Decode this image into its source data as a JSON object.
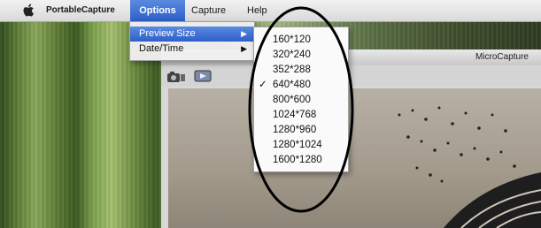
{
  "menubar": {
    "apple_icon": "apple-icon",
    "app_name": "PortableCapture",
    "items": [
      {
        "label": "Options",
        "active": true
      },
      {
        "label": "Capture",
        "active": false
      },
      {
        "label": "Help",
        "active": false
      }
    ]
  },
  "options_menu": {
    "items": [
      {
        "label": "Preview Size",
        "has_submenu": true,
        "highlighted": true
      },
      {
        "label": "Date/Time",
        "has_submenu": true,
        "highlighted": false
      }
    ],
    "submenu_arrow": "▶"
  },
  "preview_size_submenu": {
    "check_glyph": "✓",
    "options": [
      {
        "label": "160*120",
        "checked": false
      },
      {
        "label": "320*240",
        "checked": false
      },
      {
        "label": "352*288",
        "checked": false
      },
      {
        "label": "640*480",
        "checked": true
      },
      {
        "label": "800*600",
        "checked": false
      },
      {
        "label": "1024*768",
        "checked": false
      },
      {
        "label": "1280*960",
        "checked": false
      },
      {
        "label": "1280*1024",
        "checked": false
      },
      {
        "label": "1600*1280",
        "checked": false
      }
    ]
  },
  "window": {
    "title": "MicroCapture",
    "toolbar_icons": [
      "camera-icon",
      "video-icon"
    ]
  },
  "colors": {
    "menu_highlight": "#2e5fc8",
    "annotation": "#000000"
  }
}
